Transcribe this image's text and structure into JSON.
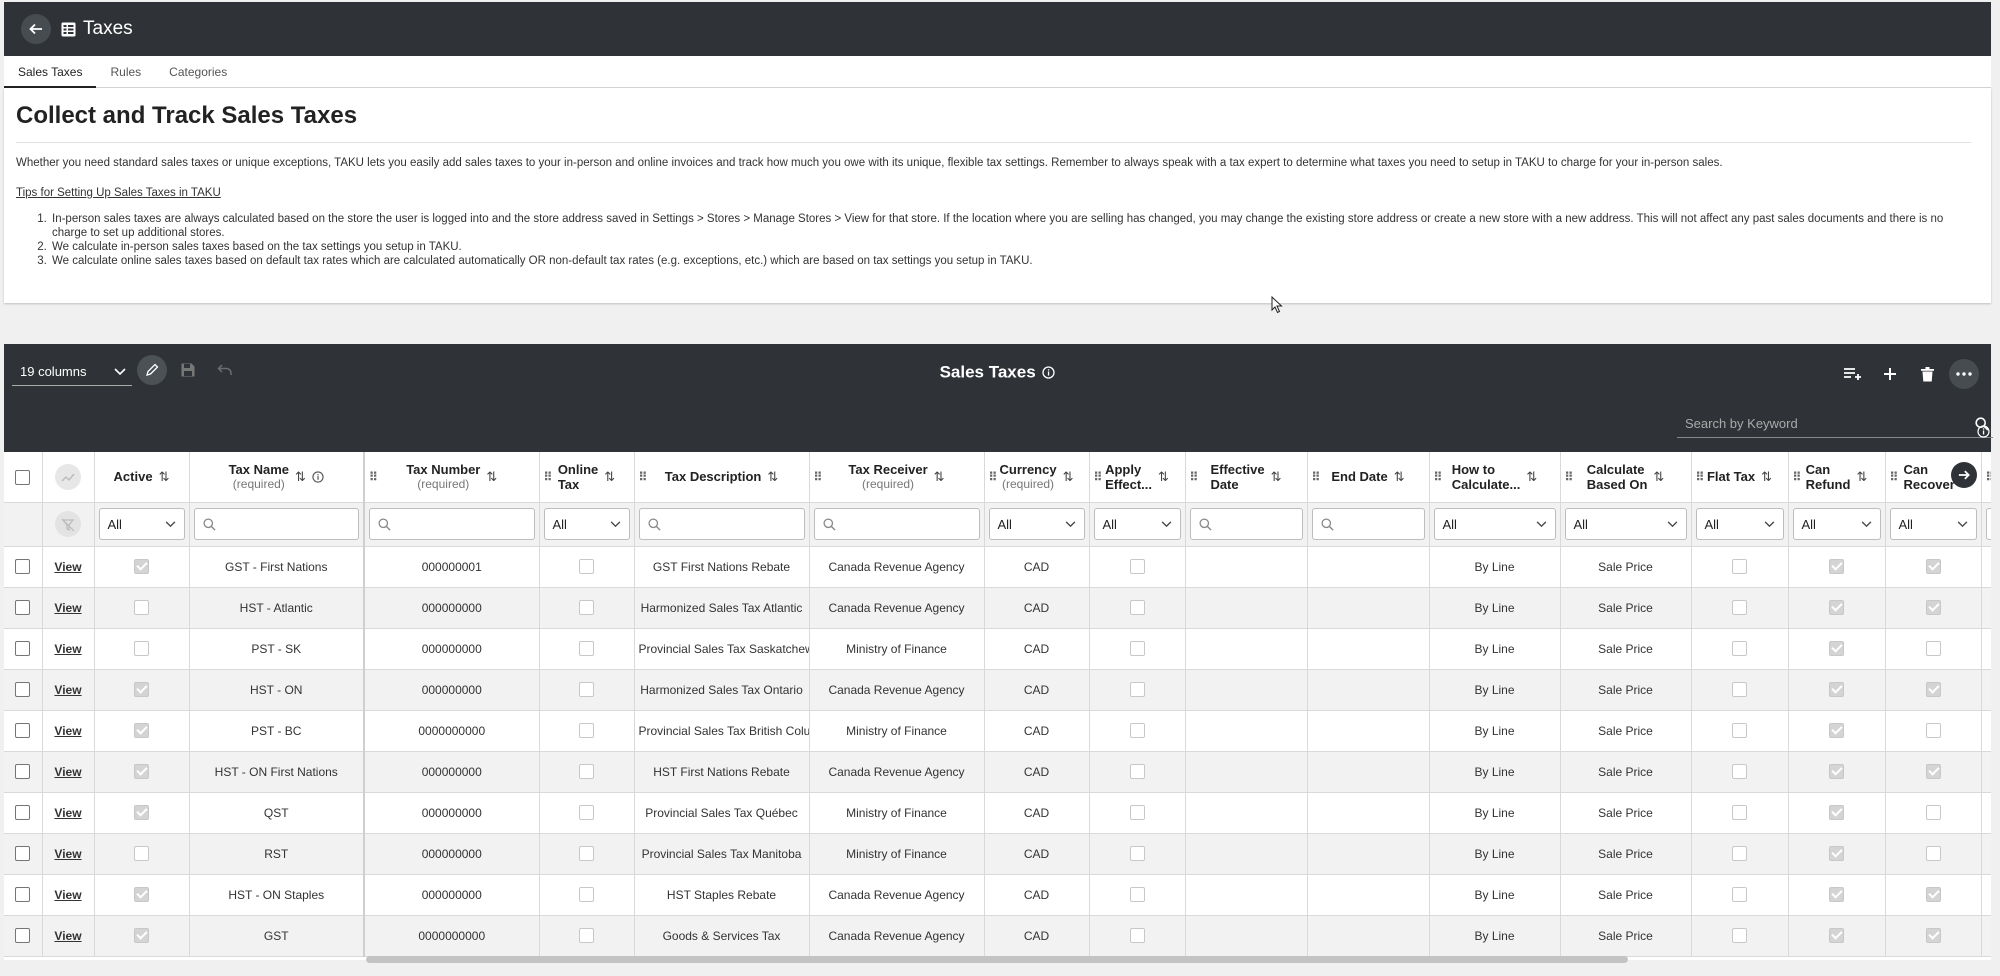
{
  "header": {
    "title": "Taxes",
    "icon": "table-icon"
  },
  "tabs": [
    {
      "label": "Sales Taxes",
      "active": true
    },
    {
      "label": "Rules",
      "active": false
    },
    {
      "label": "Categories",
      "active": false
    }
  ],
  "info": {
    "heading": "Collect and Track Sales Taxes",
    "lead": "Whether you need standard sales taxes or unique exceptions, TAKU lets you easily add sales taxes to your in-person and online invoices and track how much you owe with its unique, flexible tax settings. Remember to always speak with a tax expert to determine what taxes you need to setup in TAKU to charge for your in-person sales.",
    "tips_link": "Tips for Setting Up Sales Taxes in TAKU",
    "tips": [
      "In-person sales taxes are always calculated based on the store the user is logged into and the store address saved in Settings > Stores > Manage Stores > View for that store. If the location where you are selling has changed, you may change the existing store address or create a new store with a new address. This will not affect any past sales documents and there is no charge to set up additional stores.",
      "We calculate in-person sales taxes based on the tax settings you setup in TAKU.",
      "We calculate online sales taxes based on default tax rates which are calculated automatically OR non-default tax rates (e.g. exceptions, etc.) which are based on tax settings you setup in TAKU."
    ]
  },
  "grid": {
    "title": "Sales Taxes",
    "columns_selector": "19 columns",
    "search_placeholder": "Search by Keyword",
    "filter_all": "All",
    "view_label": "View",
    "columns": [
      {
        "key": "active",
        "label": "Active"
      },
      {
        "key": "name",
        "label": "Tax Name",
        "req": "(required)"
      },
      {
        "key": "number",
        "label": "Tax Number",
        "req": "(required)"
      },
      {
        "key": "online",
        "label": "Online",
        "label2": "Tax"
      },
      {
        "key": "desc",
        "label": "Tax Description"
      },
      {
        "key": "receiver",
        "label": "Tax Receiver",
        "req": "(required)"
      },
      {
        "key": "currency",
        "label": "Currency",
        "req": "(required)"
      },
      {
        "key": "apply",
        "label": "Apply",
        "label2": "Effect..."
      },
      {
        "key": "effective",
        "label": "Effective",
        "label2": "Date"
      },
      {
        "key": "end",
        "label": "End Date"
      },
      {
        "key": "how",
        "label": "How to",
        "label2": "Calculate..."
      },
      {
        "key": "calc",
        "label": "Calculate",
        "label2": "Based On"
      },
      {
        "key": "flat",
        "label": "Flat Tax"
      },
      {
        "key": "refund",
        "label": "Can",
        "label2": "Refund"
      },
      {
        "key": "recover",
        "label": "Can",
        "label2": "Recover"
      }
    ],
    "rows": [
      {
        "active": true,
        "name": "GST - First Nations",
        "number": "000000001",
        "online": false,
        "desc": "GST First Nations Rebate",
        "receiver": "Canada Revenue Agency",
        "currency": "CAD",
        "apply": false,
        "how": "By Line",
        "calc": "Sale Price",
        "flat": false,
        "refund": true,
        "recover": true
      },
      {
        "active": false,
        "name": "HST - Atlantic",
        "number": "000000000",
        "online": false,
        "desc": "Harmonized Sales Tax Atlantic",
        "receiver": "Canada Revenue Agency",
        "currency": "CAD",
        "apply": false,
        "how": "By Line",
        "calc": "Sale Price",
        "flat": false,
        "refund": true,
        "recover": true
      },
      {
        "active": false,
        "name": "PST - SK",
        "number": "000000000",
        "online": false,
        "desc": "Provincial Sales Tax Saskatchewan",
        "receiver": "Ministry of Finance",
        "currency": "CAD",
        "apply": false,
        "how": "By Line",
        "calc": "Sale Price",
        "flat": false,
        "refund": true,
        "recover": false
      },
      {
        "active": true,
        "name": "HST - ON",
        "number": "000000000",
        "online": false,
        "desc": "Harmonized Sales Tax Ontario",
        "receiver": "Canada Revenue Agency",
        "currency": "CAD",
        "apply": false,
        "how": "By Line",
        "calc": "Sale Price",
        "flat": false,
        "refund": true,
        "recover": true
      },
      {
        "active": true,
        "name": "PST - BC",
        "number": "0000000000",
        "online": false,
        "desc": "Provincial Sales Tax British Columbia",
        "receiver": "Ministry of Finance",
        "currency": "CAD",
        "apply": false,
        "how": "By Line",
        "calc": "Sale Price",
        "flat": false,
        "refund": true,
        "recover": false
      },
      {
        "active": true,
        "name": "HST - ON First Nations",
        "number": "000000000",
        "online": false,
        "desc": "HST First Nations Rebate",
        "receiver": "Canada Revenue Agency",
        "currency": "CAD",
        "apply": false,
        "how": "By Line",
        "calc": "Sale Price",
        "flat": false,
        "refund": true,
        "recover": true
      },
      {
        "active": true,
        "name": "QST",
        "number": "000000000",
        "online": false,
        "desc": "Provincial Sales Tax Québec",
        "receiver": "Ministry of Finance",
        "currency": "CAD",
        "apply": false,
        "how": "By Line",
        "calc": "Sale Price",
        "flat": false,
        "refund": true,
        "recover": false
      },
      {
        "active": false,
        "name": "RST",
        "number": "000000000",
        "online": false,
        "desc": "Provincial Sales Tax Manitoba",
        "receiver": "Ministry of Finance",
        "currency": "CAD",
        "apply": false,
        "how": "By Line",
        "calc": "Sale Price",
        "flat": false,
        "refund": true,
        "recover": false
      },
      {
        "active": true,
        "name": "HST - ON Staples",
        "number": "000000000",
        "online": false,
        "desc": "HST Staples Rebate",
        "receiver": "Canada Revenue Agency",
        "currency": "CAD",
        "apply": false,
        "how": "By Line",
        "calc": "Sale Price",
        "flat": false,
        "refund": true,
        "recover": true
      },
      {
        "active": true,
        "name": "GST",
        "number": "0000000000",
        "online": false,
        "desc": "Goods & Services Tax",
        "receiver": "Canada Revenue Agency",
        "currency": "CAD",
        "apply": false,
        "how": "By Line",
        "calc": "Sale Price",
        "flat": false,
        "refund": true,
        "recover": true
      }
    ]
  },
  "colors": {
    "header_bg": "#2f3337",
    "row_alt": "#f2f2f2",
    "checked": "#d4d4d4"
  }
}
